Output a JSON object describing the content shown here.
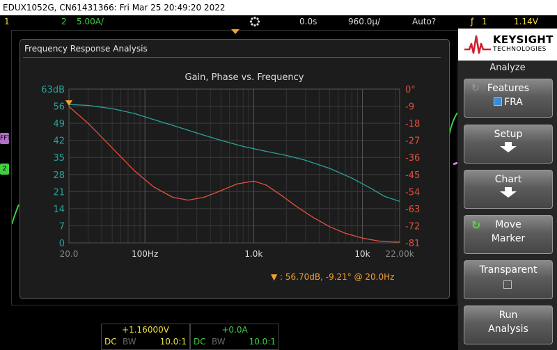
{
  "window_title": "EDUX1052G, CN61431366: Fri Mar 25 20:49:20 2022",
  "topbar": {
    "ch1_num": "1",
    "ch2_num": "2",
    "ch2_scale": "5.00A/",
    "time_pos": "0.0s",
    "time_scale": "960.0µ/",
    "trigger_mode": "Auto?",
    "trigger_slope": "ƒ",
    "trigger_src": "1",
    "trigger_level": "1.14V"
  },
  "fra": {
    "window_title": "Frequency Response Analysis",
    "chart_title": "Gain, Phase vs. Frequency",
    "marker_readout": "56.70dB, -9.21° @ 20.0Hz"
  },
  "chart_data": {
    "type": "line",
    "title": "Gain, Phase vs. Frequency",
    "x_scale": "log",
    "xlim": [
      20,
      22000
    ],
    "x_tick_labels": [
      "20.0",
      "100Hz",
      "1.0k",
      "10k",
      "22.00k"
    ],
    "x_ticks": [
      20,
      100,
      1000,
      10000,
      22000
    ],
    "y_left_ticks": [
      "63dB",
      "56",
      "49",
      "42",
      "35",
      "28",
      "21",
      "14",
      "7",
      "0"
    ],
    "ylim_left": [
      0,
      63
    ],
    "y_right_ticks": [
      "0°",
      "-9",
      "-18",
      "-27",
      "-36",
      "-45",
      "-54",
      "-63",
      "-72",
      "-81"
    ],
    "ylim_right": [
      -81,
      0
    ],
    "grid": true,
    "series": [
      {
        "axis": "left",
        "color": "#2aa39a",
        "x": [
          20,
          30,
          50,
          80,
          120,
          200,
          300,
          500,
          800,
          1200,
          2000,
          3000,
          5000,
          8000,
          12000,
          16000,
          22000
        ],
        "y": [
          56.7,
          56.3,
          55.0,
          53.0,
          50.5,
          47.5,
          45.0,
          42.0,
          39.5,
          37.8,
          35.8,
          33.8,
          30.5,
          26.5,
          22.3,
          19.0,
          17.0
        ]
      },
      {
        "axis": "right",
        "color": "#e2503c",
        "x": [
          20,
          30,
          50,
          80,
          120,
          180,
          250,
          350,
          500,
          700,
          1000,
          1300,
          1800,
          2500,
          3500,
          5000,
          7000,
          10000,
          14000,
          18000,
          22000
        ],
        "y": [
          -9.2,
          -18.0,
          -31.0,
          -43.0,
          -51.5,
          -57.0,
          -58.5,
          -57.0,
          -53.5,
          -50.0,
          -48.5,
          -50.5,
          -56.0,
          -62.0,
          -67.5,
          -72.5,
          -76.0,
          -78.5,
          -80.0,
          -80.5,
          -80.6
        ]
      }
    ]
  },
  "chan_markers": {
    "m1": "FFT",
    "m2": "2"
  },
  "bottom": {
    "ch1_offset": "+1.16000V",
    "ch1_coupling": "DC",
    "ch1_bw": "BW",
    "ch1_probe": "10.0:1",
    "ch2_offset": "+0.0A",
    "ch2_coupling": "DC",
    "ch2_bw": "BW",
    "ch2_probe": "10.0:1"
  },
  "sidebar": {
    "brand": "KEYSIGHT",
    "brand_sub": "TECHNOLOGIES",
    "menu_title": "Analyze",
    "buttons": {
      "features": "Features",
      "features_sub": "FRA",
      "setup": "Setup",
      "chart": "Chart",
      "move1": "Move",
      "move2": "Marker",
      "transparent": "Transparent",
      "run1": "Run",
      "run2": "Analysis"
    }
  },
  "colors": {
    "ch1": "#f0e040",
    "ch2": "#40d040",
    "gain": "#2aa39a",
    "phase": "#e2503c",
    "marker": "#f0a030"
  }
}
